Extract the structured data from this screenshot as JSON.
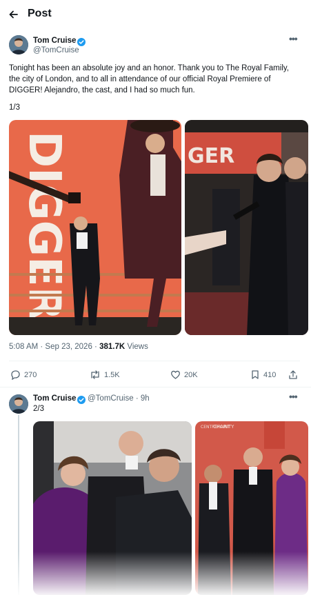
{
  "header": {
    "title": "Post"
  },
  "main_post": {
    "author_name": "Tom Cruise",
    "handle": "@TomCruise",
    "text": "Tonight has been an absolute joy and an honor. Thank you to The Royal Family, the city of London, and to all in attendance of our official Royal Premiere of DIGGER! Alejandro, the cast, and I had so much fun.",
    "thread_count": "1/3",
    "poster_text": "DIGGER",
    "backdrop_text": "GER",
    "timestamp": "5:08 AM · Sep 23, 2026 · ",
    "views_count": "381.7K",
    "views_label": " Views",
    "actions": {
      "replies": "270",
      "reposts": "1.5K",
      "likes": "20K",
      "bookmarks": "410"
    }
  },
  "reply_post": {
    "author_name": "Tom Cruise",
    "handle_time": "@TomCruise · 9h",
    "thread_count": "2/3",
    "backdrop_text": "CHARITY",
    "backdrop_logo": "CENTREPOINT"
  },
  "colors": {
    "verified": "#1d9bf0",
    "poster_orange": "#e8694a",
    "muted": "#536471"
  }
}
